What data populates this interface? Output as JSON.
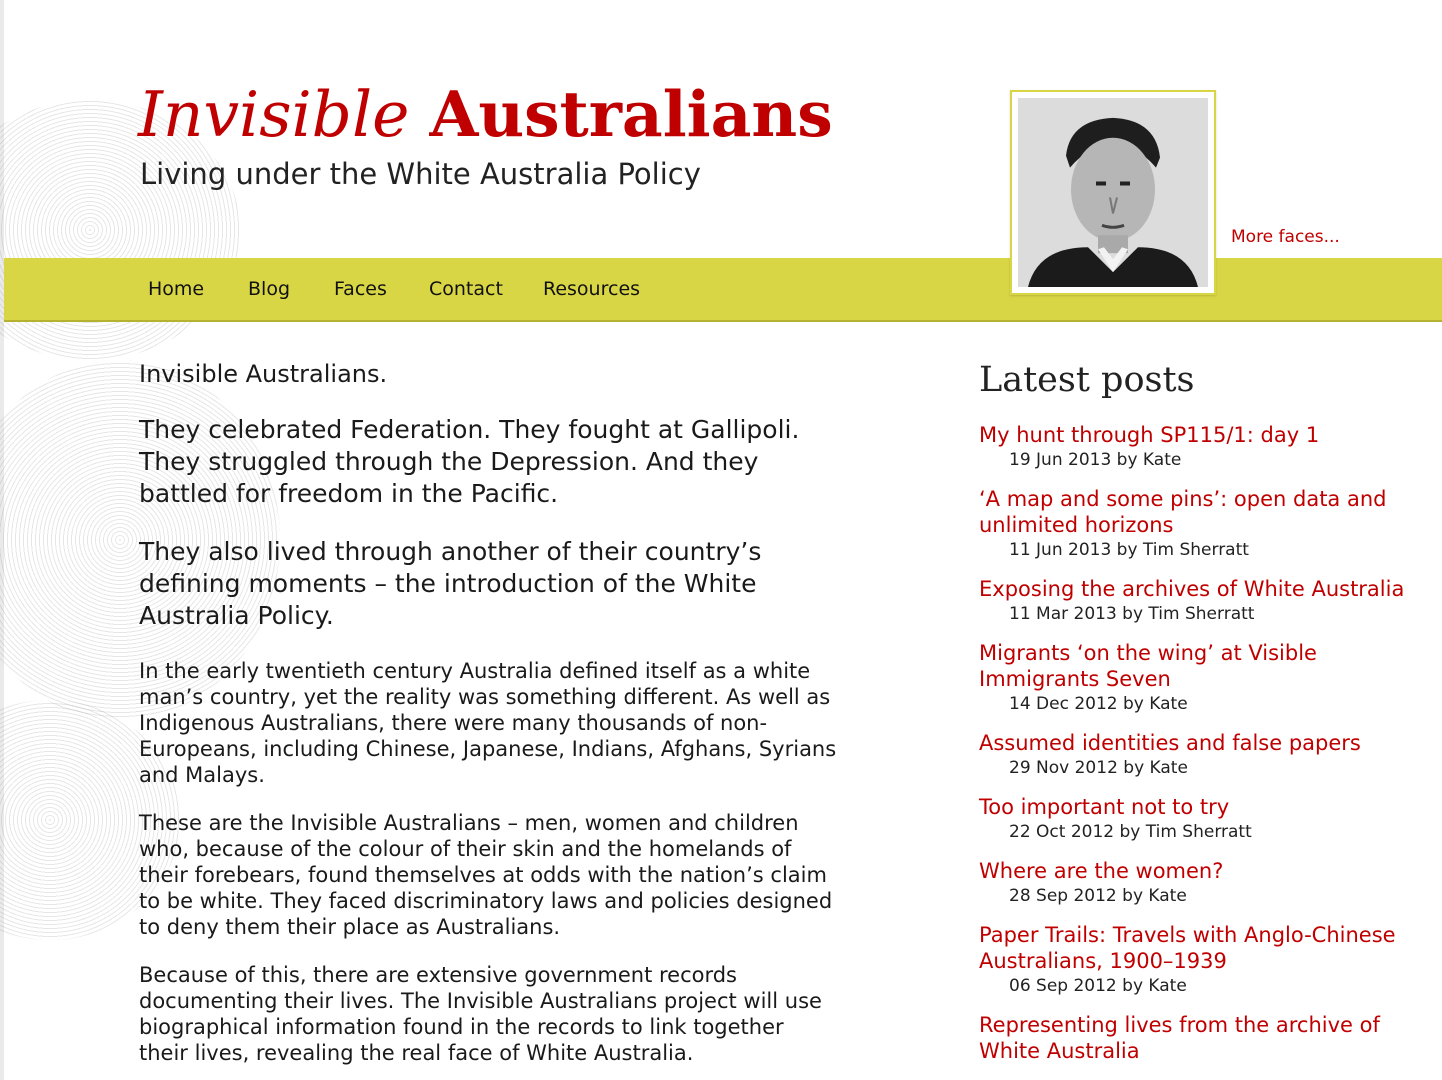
{
  "header": {
    "title_italic": "Invisible",
    "title_bold": "Australians",
    "tagline": "Living under the White Australia Policy",
    "more_faces": "More faces..."
  },
  "nav": [
    "Home",
    "Blog",
    "Faces",
    "Contact",
    "Resources"
  ],
  "main": {
    "intro": "Invisible Australians.",
    "lead1": "They celebrated Federation. They fought at Gallipoli. They struggled through the Depression. And they battled for freedom in the Pacific.",
    "lead2": "They also lived through another of their country’s defining moments – the introduction of the White Australia Policy.",
    "body1": "In the early twentieth century Australia defined itself as a white man’s country, yet the reality was something different. As well as Indigenous Australians, there were many thousands of non-Europeans, including Chinese, Japanese, Indians, Afghans, Syrians and Malays.",
    "body2": "These are the Invisible Australians – men, women and children who, because of the colour of their skin and the homelands of their forebears, found themselves at odds with the nation’s claim to be white. They faced discriminatory laws and policies designed to deny them their place as Australians.",
    "body3": "Because of this, there are extensive government records documenting their lives. The Invisible Australians project will use biographical information found in the records to link together their lives, revealing the real face of White Australia."
  },
  "sidebar": {
    "heading": "Latest posts",
    "posts": [
      {
        "title": "My hunt through SP115/1: day 1",
        "meta": "19 Jun 2013 by Kate"
      },
      {
        "title": "‘A map and some pins’: open data and unlimited horizons",
        "meta": "11 Jun 2013 by Tim Sherratt"
      },
      {
        "title": "Exposing the archives of White Australia",
        "meta": "11 Mar 2013 by Tim Sherratt"
      },
      {
        "title": "Migrants ‘on the wing’ at Visible Immigrants Seven",
        "meta": "14 Dec 2012 by Kate"
      },
      {
        "title": "Assumed identities and false papers",
        "meta": "29 Nov 2012 by Kate"
      },
      {
        "title": "Too important not to try",
        "meta": "22 Oct 2012 by Tim Sherratt"
      },
      {
        "title": "Where are the women?",
        "meta": "28 Sep 2012 by Kate"
      },
      {
        "title": "Paper Trails: Travels with Anglo-Chinese Australians, 1900–1939",
        "meta": "06 Sep 2012 by Kate"
      },
      {
        "title": "Representing lives from the archive of White Australia",
        "meta": ""
      }
    ]
  },
  "colors": {
    "accent_red": "#c00000",
    "nav_yellow": "#d9d646"
  }
}
